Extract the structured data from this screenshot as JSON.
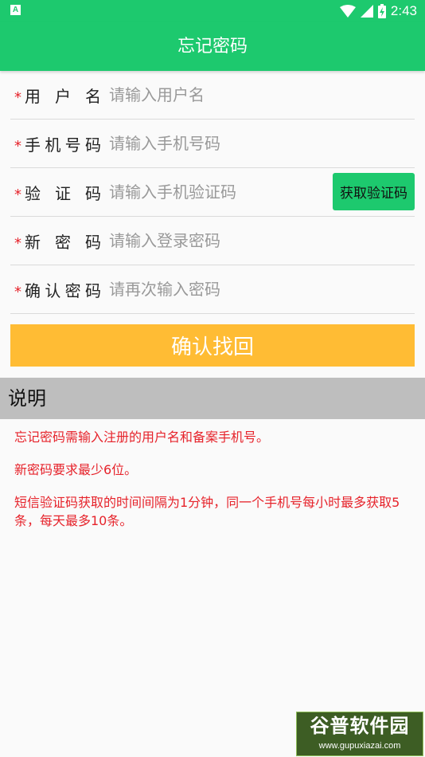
{
  "status": {
    "app_icon": "A",
    "time": "2:43"
  },
  "title": "忘记密码",
  "form": {
    "required_mark": "*",
    "username": {
      "label_chars": [
        "用",
        "户",
        "名"
      ],
      "placeholder": "请输入用户名"
    },
    "phone": {
      "label_chars": [
        "手",
        "机",
        "号",
        "码"
      ],
      "placeholder": "请输入手机号码"
    },
    "code": {
      "label_chars": [
        "验",
        "证",
        "码"
      ],
      "placeholder": "请输入手机验证码",
      "button": "获取验证码"
    },
    "new_password": {
      "label_chars": [
        "新",
        "密",
        "码"
      ],
      "placeholder": "请输入登录密码"
    },
    "confirm_password": {
      "label_chars": [
        "确",
        "认",
        "密",
        "码"
      ],
      "placeholder": "请再次输入密码"
    }
  },
  "confirm_button": "确认找回",
  "notes": {
    "header": "说明",
    "lines": [
      "忘记密码需输入注册的用户名和备案手机号。",
      "新密码要求最少6位。",
      "短信验证码获取的时间间隔为1分钟，同一个手机号每小时最多获取5条，每天最多10条。"
    ]
  },
  "watermark": {
    "text": "谷普软件园",
    "url": "www.gupuxiazai.com"
  },
  "colors": {
    "primary": "#1dc96e",
    "accent": "#ffbc34",
    "required": "#e6232b",
    "notes_header": "#bebebe"
  }
}
